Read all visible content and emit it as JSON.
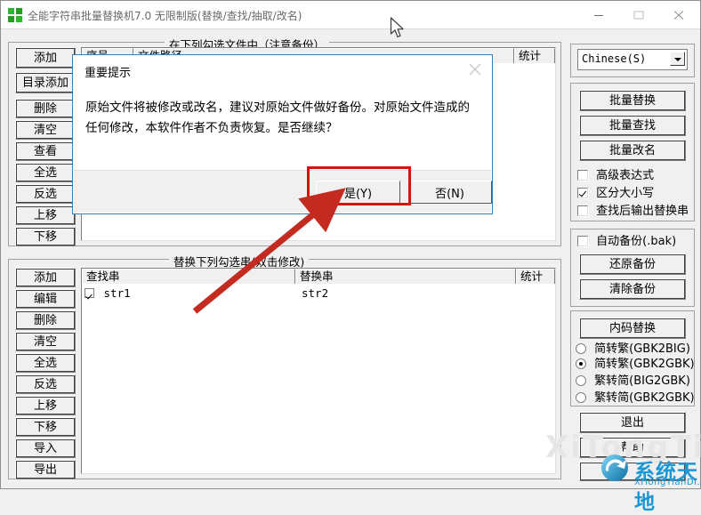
{
  "window": {
    "title": "全能字符串批量替换机7.0 无限制版(替换/查找/抽取/改名)",
    "icon": "app-icon",
    "minimize_label": "—",
    "maximize_label": "□",
    "close_label": "✕"
  },
  "files_group": {
    "title": "在下列勾选文件中（注意备份）",
    "columns": [
      "序号",
      "文件路径",
      "统计"
    ],
    "rows": []
  },
  "files_buttons": [
    {
      "label": "添加",
      "name": "file-add-button"
    },
    {
      "label": "目录添加",
      "name": "file-add-dir-button"
    },
    {
      "label": "删除",
      "name": "file-delete-button"
    },
    {
      "label": "清空",
      "name": "file-clear-button"
    },
    {
      "label": "查看",
      "name": "file-view-button"
    },
    {
      "label": "全选",
      "name": "file-select-all-button"
    },
    {
      "label": "反选",
      "name": "file-invert-select-button"
    },
    {
      "label": "上移",
      "name": "file-move-up-button"
    },
    {
      "label": "下移",
      "name": "file-move-down-button"
    }
  ],
  "strings_group": {
    "title": "替换下列勾选串(双击修改)",
    "columns": [
      "查找串",
      "替换串",
      "统计"
    ],
    "rows": [
      {
        "checked": true,
        "find": "str1",
        "replace": "str2",
        "count": ""
      }
    ]
  },
  "strings_buttons": [
    {
      "label": "添加",
      "name": "str-add-button"
    },
    {
      "label": "编辑",
      "name": "str-edit-button"
    },
    {
      "label": "删除",
      "name": "str-delete-button"
    },
    {
      "label": "清空",
      "name": "str-clear-button"
    },
    {
      "label": "全选",
      "name": "str-select-all-button"
    },
    {
      "label": "反选",
      "name": "str-invert-select-button"
    },
    {
      "label": "上移",
      "name": "str-move-up-button"
    },
    {
      "label": "下移",
      "name": "str-move-down-button"
    },
    {
      "label": "导入",
      "name": "str-import-button"
    },
    {
      "label": "导出",
      "name": "str-export-button"
    }
  ],
  "right_panel": {
    "language_combo": {
      "value": "Chinese(S)",
      "options": [
        "Chinese(S)"
      ]
    },
    "actions": [
      {
        "label": "批量替换",
        "name": "batch-replace-button"
      },
      {
        "label": "批量查找",
        "name": "batch-find-button"
      },
      {
        "label": "批量改名",
        "name": "batch-rename-button"
      }
    ],
    "options": [
      {
        "label": "高级表达式",
        "checked": false,
        "name": "advanced-expression-checkbox"
      },
      {
        "label": "区分大小写",
        "checked": true,
        "name": "case-sensitive-checkbox"
      },
      {
        "label": "查找后输出替换串",
        "checked": false,
        "name": "output-replace-string-checkbox"
      }
    ],
    "backup": {
      "auto_backup": {
        "label": "自动备份(.bak)",
        "checked": false
      },
      "restore_label": "还原备份",
      "clear_label": "清除备份"
    },
    "encoding": {
      "button_label": "内码替换",
      "radios": [
        {
          "label": "简转繁(GBK2BIG)",
          "selected": false
        },
        {
          "label": "简转繁(GBK2GBK)",
          "selected": true
        },
        {
          "label": "繁转简(BIG2GBK)",
          "selected": false
        },
        {
          "label": "繁转简(GBK2GBK)",
          "selected": false
        }
      ]
    },
    "exit_label": "退出",
    "help_label": "帮助"
  },
  "dialog": {
    "title": "重要提示",
    "message": "原始文件将被修改或改名，建议对原始文件做好备份。对原始文件造成的任何修改，本软件作者不负责恢复。是否继续？",
    "yes_label": "是(Y)",
    "no_label": "否(N)",
    "close_label": "✕"
  },
  "annotations": {
    "highlight_color": "#d6130f",
    "arrow_color": "#c32a20",
    "arrow_target": "是(Y)"
  },
  "watermark": {
    "text": "系统天地",
    "sub": "XiTongTianDi.net",
    "ghost": "XiTongTianDi",
    "color": "#1b97d4"
  }
}
